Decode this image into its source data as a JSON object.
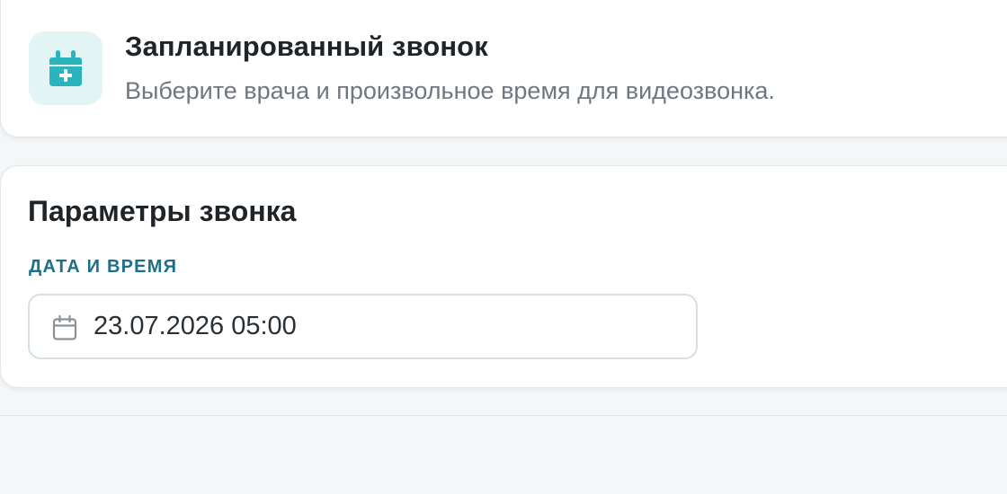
{
  "header": {
    "title": "Запланированный звонок",
    "subtitle": "Выберите врача и произвольное время для видеозвонка.",
    "icon": "calendar-plus-icon"
  },
  "params": {
    "section_title": "Параметры звонка",
    "datetime_label": "ДАТА И ВРЕМЯ",
    "datetime_value": "23.07.2026 05:00",
    "datetime_icon": "calendar-icon"
  },
  "colors": {
    "accent": "#2bb4bd",
    "accent_soft": "#e3f4f5",
    "label": "#1d7088",
    "title": "#1f2429",
    "muted": "#6f7780"
  }
}
